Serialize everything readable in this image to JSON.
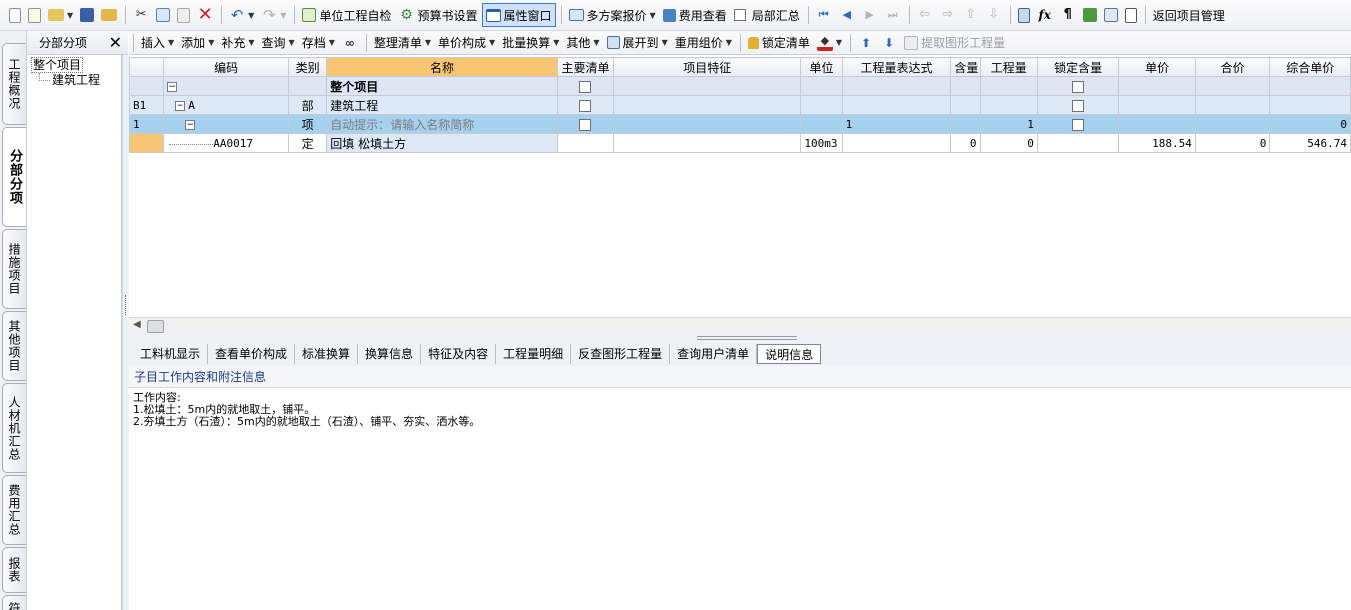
{
  "toolbar1": {
    "self_check": "单位工程自检",
    "book_settings": "预算书设置",
    "property_window": "属性窗口",
    "multi_quote": "多方案报价",
    "fee_view": "费用查看",
    "partial_summary": "局部汇总",
    "back_to_project": "返回项目管理"
  },
  "vtabs": [
    "工程概况",
    "分部分项",
    "措施项目",
    "其他项目",
    "人材机汇总",
    "费用汇总",
    "报表",
    "符合"
  ],
  "tree": {
    "header": "分部分项",
    "root": "整个项目",
    "child": "建筑工程"
  },
  "toolbar2": {
    "insert": "插入",
    "add": "添加",
    "supplement": "补充",
    "query": "查询",
    "archive": "存档",
    "organize_list": "整理清单",
    "unit_composition": "单价构成",
    "batch_convert": "批量换算",
    "other": "其他",
    "expand_to": "展开到",
    "reuse_group": "重用组价",
    "lock_list": "锁定清单",
    "extract_graphic": "提取图形工程量"
  },
  "grid": {
    "columns": [
      "编码",
      "类别",
      "名称",
      "主要清单",
      "项目特征",
      "单位",
      "工程量表达式",
      "含量",
      "工程量",
      "锁定含量",
      "单价",
      "合价",
      "综合单价"
    ],
    "rows": [
      {
        "rowhead": "",
        "code": "",
        "type": "",
        "name": "整个项目",
        "unit": "",
        "expr": "",
        "content": "",
        "qty": "",
        "price": "",
        "total": "",
        "comp_price": ""
      },
      {
        "rowhead": "B1",
        "code": "A",
        "type": "部",
        "name": "建筑工程",
        "unit": "",
        "expr": "",
        "content": "",
        "qty": "",
        "price": "",
        "total": "",
        "comp_price": ""
      },
      {
        "rowhead": "1",
        "code": "",
        "type": "项",
        "name": "自动提示：请输入名称简称",
        "unit": "",
        "expr": "1",
        "content": "",
        "qty": "1",
        "price": "",
        "total": "",
        "comp_price": "0"
      },
      {
        "rowhead": "",
        "code": "AA0017",
        "type": "定",
        "name": "回填 松填土方",
        "unit": "100m3",
        "expr": "",
        "content": "0",
        "qty": "0",
        "price": "188.54",
        "total": "0",
        "comp_price": "546.74"
      }
    ]
  },
  "bottom_tabs": [
    "工料机显示",
    "查看单价构成",
    "标准换算",
    "换算信息",
    "特征及内容",
    "工程量明细",
    "反查图形工程量",
    "查询用户清单",
    "说明信息"
  ],
  "info": {
    "title": "子目工作内容和附注信息",
    "lines": [
      "工作内容:",
      "1.松填土：5m内的就地取土，铺平。",
      "2.夯填土方（石渣）：5m内的就地取土（石渣）、铺平、夯实、洒水等。"
    ]
  },
  "colors": {
    "selected_header": "#f8c673",
    "selected_row": "#a5d0ee",
    "info_title": "#1c3a8c"
  }
}
